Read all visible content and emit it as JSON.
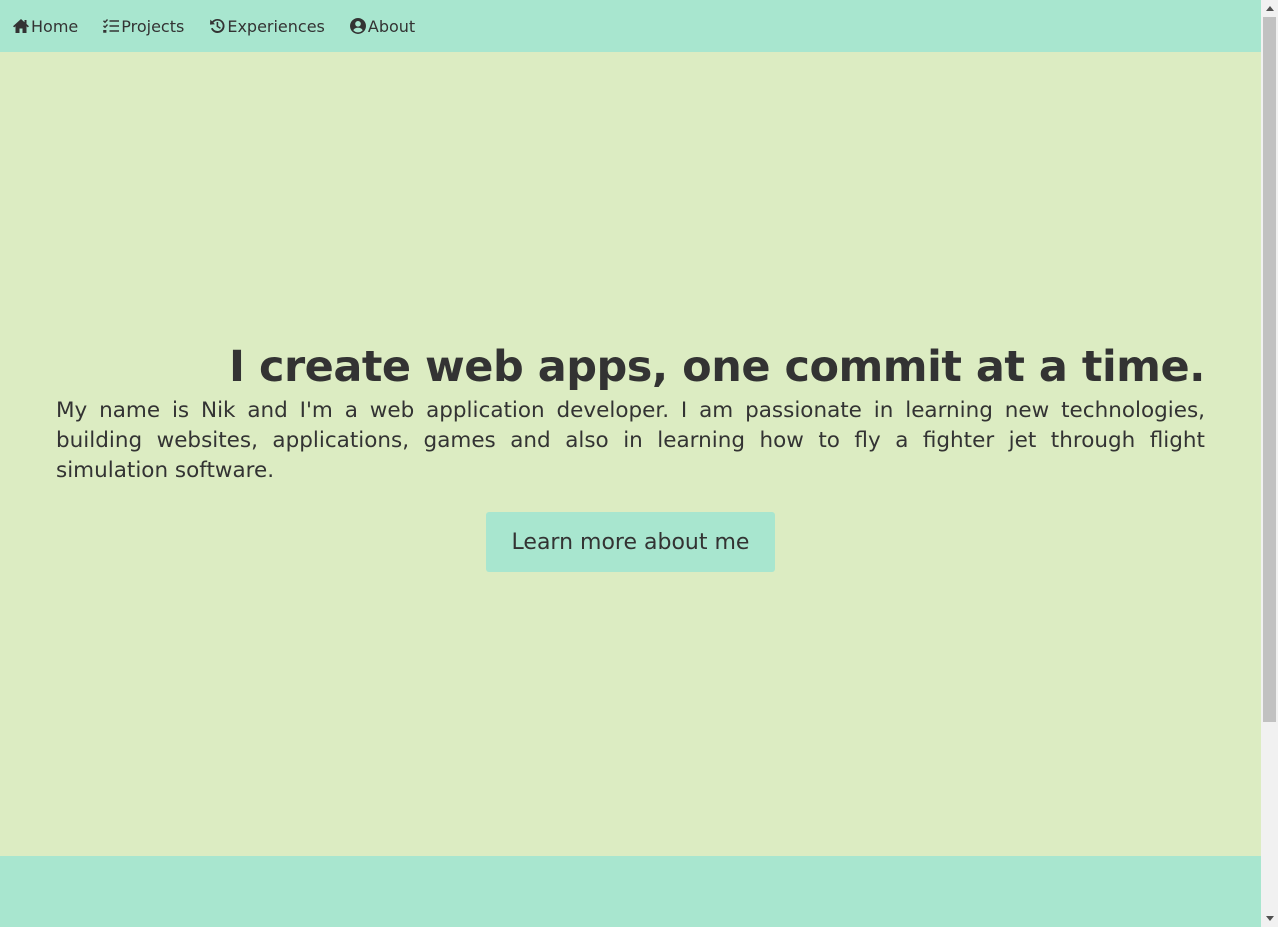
{
  "nav": {
    "items": [
      {
        "label": "Home",
        "icon": "home-icon"
      },
      {
        "label": "Projects",
        "icon": "list-check-icon"
      },
      {
        "label": "Experiences",
        "icon": "history-icon"
      },
      {
        "label": "About",
        "icon": "user-circle-icon"
      }
    ]
  },
  "hero": {
    "headline": "I create web apps, one commit at a time.",
    "intro": "My name is Nik and I'm a web application developer. I am passionate in learning new technologies, building websites, applications, games and also in learning how to fly a fighter jet through flight simulation software.",
    "cta_label": "Learn more about me"
  },
  "colors": {
    "nav_background": "#a8e6cf",
    "page_background": "#dcecc2",
    "footer_background": "#a8e6cf",
    "button_background": "#a8e6cf",
    "text": "#333333"
  }
}
